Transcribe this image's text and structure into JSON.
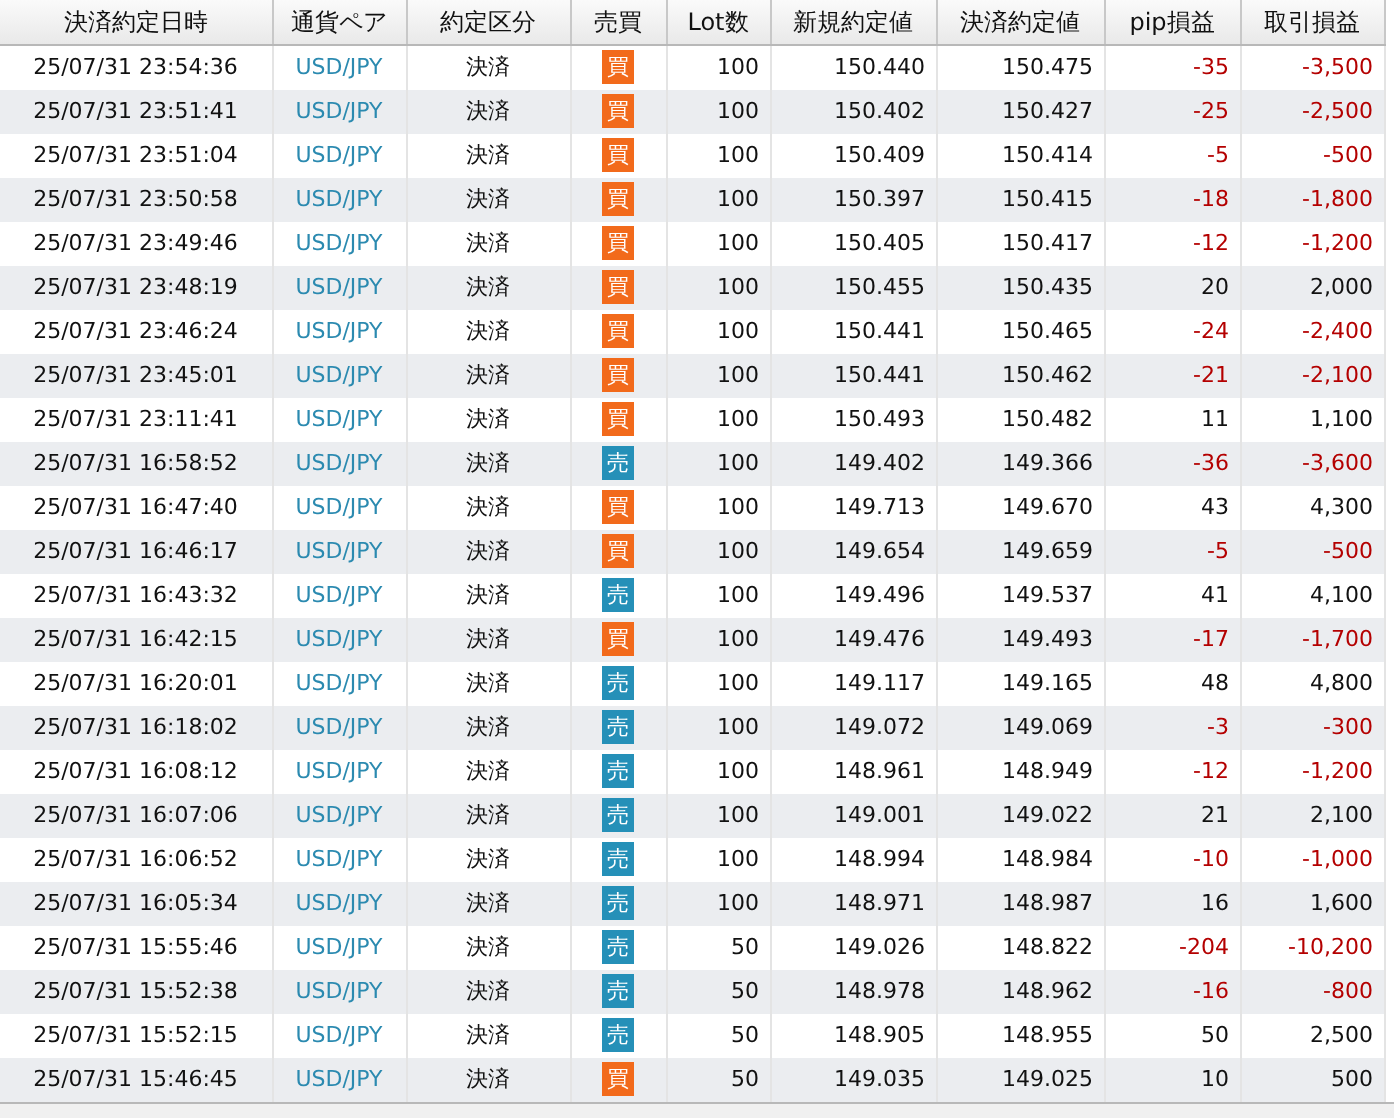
{
  "table": {
    "columns": [
      "決済約定日時",
      "通貨ペア",
      "約定区分",
      "売買",
      "Lot数",
      "新規約定値",
      "決済約定値",
      "pip損益",
      "取引損益"
    ],
    "rows": [
      {
        "datetime": "25/07/31 23:54:36",
        "pair": "USD/JPY",
        "type": "決済",
        "side": "買",
        "kind": "buy",
        "lots": "100",
        "open": "150.440",
        "close": "150.475",
        "pips": "-35",
        "profit": "-3,500",
        "loss": true
      },
      {
        "datetime": "25/07/31 23:51:41",
        "pair": "USD/JPY",
        "type": "決済",
        "side": "買",
        "kind": "buy",
        "lots": "100",
        "open": "150.402",
        "close": "150.427",
        "pips": "-25",
        "profit": "-2,500",
        "loss": true
      },
      {
        "datetime": "25/07/31 23:51:04",
        "pair": "USD/JPY",
        "type": "決済",
        "side": "買",
        "kind": "buy",
        "lots": "100",
        "open": "150.409",
        "close": "150.414",
        "pips": "-5",
        "profit": "-500",
        "loss": true
      },
      {
        "datetime": "25/07/31 23:50:58",
        "pair": "USD/JPY",
        "type": "決済",
        "side": "買",
        "kind": "buy",
        "lots": "100",
        "open": "150.397",
        "close": "150.415",
        "pips": "-18",
        "profit": "-1,800",
        "loss": true
      },
      {
        "datetime": "25/07/31 23:49:46",
        "pair": "USD/JPY",
        "type": "決済",
        "side": "買",
        "kind": "buy",
        "lots": "100",
        "open": "150.405",
        "close": "150.417",
        "pips": "-12",
        "profit": "-1,200",
        "loss": true
      },
      {
        "datetime": "25/07/31 23:48:19",
        "pair": "USD/JPY",
        "type": "決済",
        "side": "買",
        "kind": "buy",
        "lots": "100",
        "open": "150.455",
        "close": "150.435",
        "pips": "20",
        "profit": "2,000",
        "loss": false
      },
      {
        "datetime": "25/07/31 23:46:24",
        "pair": "USD/JPY",
        "type": "決済",
        "side": "買",
        "kind": "buy",
        "lots": "100",
        "open": "150.441",
        "close": "150.465",
        "pips": "-24",
        "profit": "-2,400",
        "loss": true
      },
      {
        "datetime": "25/07/31 23:45:01",
        "pair": "USD/JPY",
        "type": "決済",
        "side": "買",
        "kind": "buy",
        "lots": "100",
        "open": "150.441",
        "close": "150.462",
        "pips": "-21",
        "profit": "-2,100",
        "loss": true
      },
      {
        "datetime": "25/07/31 23:11:41",
        "pair": "USD/JPY",
        "type": "決済",
        "side": "買",
        "kind": "buy",
        "lots": "100",
        "open": "150.493",
        "close": "150.482",
        "pips": "11",
        "profit": "1,100",
        "loss": false
      },
      {
        "datetime": "25/07/31 16:58:52",
        "pair": "USD/JPY",
        "type": "決済",
        "side": "売",
        "kind": "sell",
        "lots": "100",
        "open": "149.402",
        "close": "149.366",
        "pips": "-36",
        "profit": "-3,600",
        "loss": true
      },
      {
        "datetime": "25/07/31 16:47:40",
        "pair": "USD/JPY",
        "type": "決済",
        "side": "買",
        "kind": "buy",
        "lots": "100",
        "open": "149.713",
        "close": "149.670",
        "pips": "43",
        "profit": "4,300",
        "loss": false
      },
      {
        "datetime": "25/07/31 16:46:17",
        "pair": "USD/JPY",
        "type": "決済",
        "side": "買",
        "kind": "buy",
        "lots": "100",
        "open": "149.654",
        "close": "149.659",
        "pips": "-5",
        "profit": "-500",
        "loss": true
      },
      {
        "datetime": "25/07/31 16:43:32",
        "pair": "USD/JPY",
        "type": "決済",
        "side": "売",
        "kind": "sell",
        "lots": "100",
        "open": "149.496",
        "close": "149.537",
        "pips": "41",
        "profit": "4,100",
        "loss": false
      },
      {
        "datetime": "25/07/31 16:42:15",
        "pair": "USD/JPY",
        "type": "決済",
        "side": "買",
        "kind": "buy",
        "lots": "100",
        "open": "149.476",
        "close": "149.493",
        "pips": "-17",
        "profit": "-1,700",
        "loss": true
      },
      {
        "datetime": "25/07/31 16:20:01",
        "pair": "USD/JPY",
        "type": "決済",
        "side": "売",
        "kind": "sell",
        "lots": "100",
        "open": "149.117",
        "close": "149.165",
        "pips": "48",
        "profit": "4,800",
        "loss": false
      },
      {
        "datetime": "25/07/31 16:18:02",
        "pair": "USD/JPY",
        "type": "決済",
        "side": "売",
        "kind": "sell",
        "lots": "100",
        "open": "149.072",
        "close": "149.069",
        "pips": "-3",
        "profit": "-300",
        "loss": true
      },
      {
        "datetime": "25/07/31 16:08:12",
        "pair": "USD/JPY",
        "type": "決済",
        "side": "売",
        "kind": "sell",
        "lots": "100",
        "open": "148.961",
        "close": "148.949",
        "pips": "-12",
        "profit": "-1,200",
        "loss": true
      },
      {
        "datetime": "25/07/31 16:07:06",
        "pair": "USD/JPY",
        "type": "決済",
        "side": "売",
        "kind": "sell",
        "lots": "100",
        "open": "149.001",
        "close": "149.022",
        "pips": "21",
        "profit": "2,100",
        "loss": false
      },
      {
        "datetime": "25/07/31 16:06:52",
        "pair": "USD/JPY",
        "type": "決済",
        "side": "売",
        "kind": "sell",
        "lots": "100",
        "open": "148.994",
        "close": "148.984",
        "pips": "-10",
        "profit": "-1,000",
        "loss": true
      },
      {
        "datetime": "25/07/31 16:05:34",
        "pair": "USD/JPY",
        "type": "決済",
        "side": "売",
        "kind": "sell",
        "lots": "100",
        "open": "148.971",
        "close": "148.987",
        "pips": "16",
        "profit": "1,600",
        "loss": false
      },
      {
        "datetime": "25/07/31 15:55:46",
        "pair": "USD/JPY",
        "type": "決済",
        "side": "売",
        "kind": "sell",
        "lots": "50",
        "open": "149.026",
        "close": "148.822",
        "pips": "-204",
        "profit": "-10,200",
        "loss": true
      },
      {
        "datetime": "25/07/31 15:52:38",
        "pair": "USD/JPY",
        "type": "決済",
        "side": "売",
        "kind": "sell",
        "lots": "50",
        "open": "148.978",
        "close": "148.962",
        "pips": "-16",
        "profit": "-800",
        "loss": true
      },
      {
        "datetime": "25/07/31 15:52:15",
        "pair": "USD/JPY",
        "type": "決済",
        "side": "売",
        "kind": "sell",
        "lots": "50",
        "open": "148.905",
        "close": "148.955",
        "pips": "50",
        "profit": "2,500",
        "loss": false
      },
      {
        "datetime": "25/07/31 15:46:45",
        "pair": "USD/JPY",
        "type": "決済",
        "side": "買",
        "kind": "buy",
        "lots": "50",
        "open": "149.035",
        "close": "149.025",
        "pips": "10",
        "profit": "500",
        "loss": false
      }
    ]
  }
}
